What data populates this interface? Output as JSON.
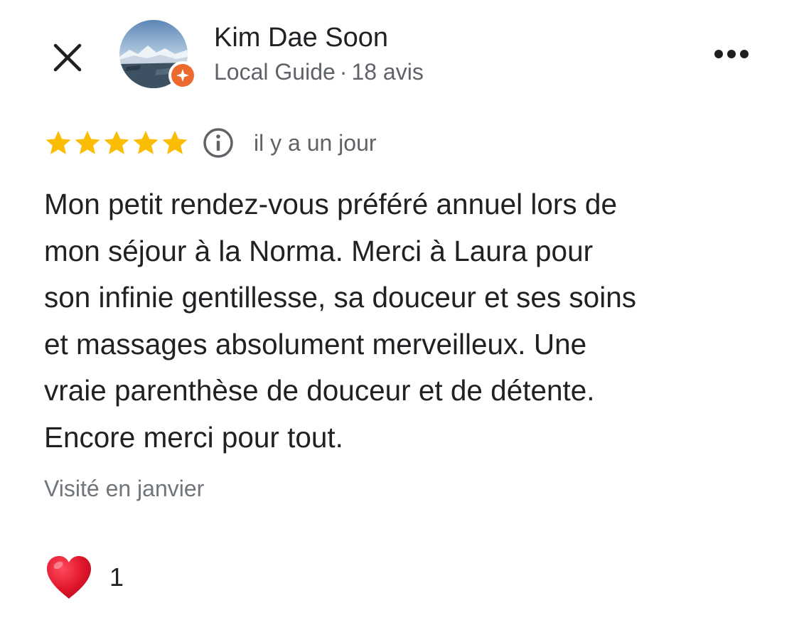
{
  "header": {
    "close_icon": "close-icon",
    "more_icon": "more-horizontal-icon"
  },
  "author": {
    "name": "Kim Dae Soon",
    "level": "Local Guide",
    "separator": "·",
    "review_count": "18 avis",
    "badge_icon": "local-guide-star-icon",
    "badge_color": "#ec6a2d"
  },
  "rating": {
    "stars": 5,
    "max_stars": 5,
    "star_color": "#fbbc04",
    "info_icon": "info-icon",
    "time_ago": "il y a un jour"
  },
  "review": {
    "text": "Mon petit rendez-vous préféré annuel lors de\nmon séjour à la Norma. Merci à Laura pour\nson infinie gentillesse, sa douceur et ses soins\net massages absolument merveilleux. Une\nvraie parenthèse de douceur et de détente.\nEncore merci pour tout.",
    "visited": "Visité en janvier"
  },
  "reaction": {
    "icon": "red-heart-icon",
    "count": "1"
  }
}
